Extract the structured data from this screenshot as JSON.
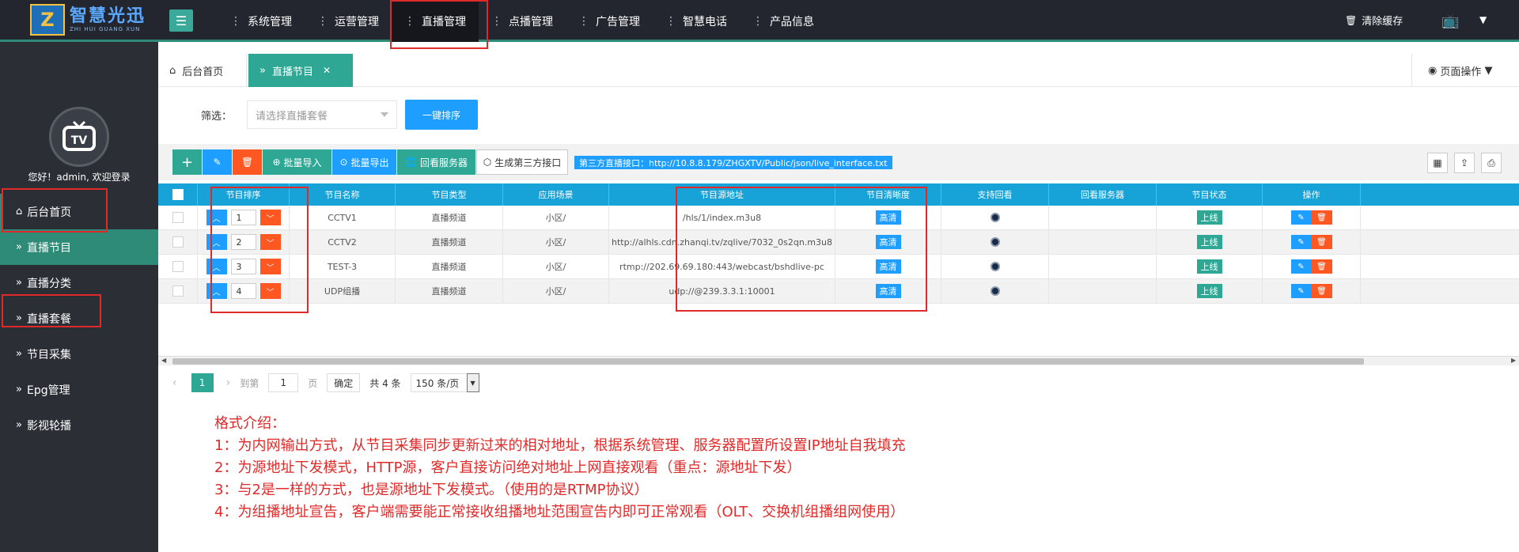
{
  "app": {
    "logo_mark": "Z",
    "logo_cn": "智慧光迅",
    "logo_en": "ZHI HUI GUANG XUN"
  },
  "topnav": {
    "items": [
      "系统管理",
      "运营管理",
      "直播管理",
      "点播管理",
      "广告管理",
      "智慧电话",
      "产品信息"
    ],
    "active": "直播管理",
    "clear_cache": "清除缓存"
  },
  "sidebar": {
    "welcome": "您好！admin, 欢迎登录",
    "items": [
      "后台首页",
      "直播节目",
      "直播分类",
      "直播套餐",
      "节目采集",
      "Epg管理",
      "影视轮播"
    ],
    "active": "直播节目"
  },
  "tabs": {
    "home": "后台首页",
    "current": "直播节目",
    "page_ops": "页面操作"
  },
  "filter": {
    "label": "筛选：",
    "placeholder": "请选择直播套餐",
    "sort_button": "一键排序"
  },
  "toolbar": {
    "import": "批量导入",
    "export": "批量导出",
    "server": "回看服务器",
    "generate": "生成第三方接口",
    "api_link": "第三方直播接口：http://10.8.8.179/ZHGXTV/Public/json/live_interface.txt"
  },
  "table": {
    "headers": [
      "节目排序",
      "节目名称",
      "节目类型",
      "应用场景",
      "节目源地址",
      "节目清晰度",
      "支持回看",
      "回看服务器",
      "节目状态",
      "操作"
    ],
    "rows": [
      {
        "order": "1",
        "name": "CCTV1",
        "type": "直播频道",
        "scene": "小区/",
        "source": "/hls/1/index.m3u8",
        "quality": "高清",
        "server": "",
        "status": "上线"
      },
      {
        "order": "2",
        "name": "CCTV2",
        "type": "直播频道",
        "scene": "小区/",
        "source": "http://alhls.cdn.zhanqi.tv/zqlive/7032_0s2qn.m3u8",
        "quality": "高清",
        "server": "",
        "status": "上线"
      },
      {
        "order": "3",
        "name": "TEST-3",
        "type": "直播频道",
        "scene": "小区/",
        "source": "rtmp://202.69.69.180:443/webcast/bshdlive-pc",
        "quality": "高清",
        "server": "",
        "status": "上线"
      },
      {
        "order": "4",
        "name": "UDP组播",
        "type": "直播频道",
        "scene": "小区/",
        "source": "udp://@239.3.3.1:10001",
        "quality": "高清",
        "server": "",
        "status": "上线"
      }
    ]
  },
  "pager": {
    "current": "1",
    "goto_label": "到第",
    "goto_value": "1",
    "page_label": "页",
    "ok": "确定",
    "total": "共 4 条",
    "page_size": "150 条/页"
  },
  "notes": [
    "格式介绍：",
    "1：为内网输出方式，从节目采集同步更新过来的相对地址，根据系统管理、服务器配置所设置IP地址自我填充",
    "2：为源地址下发模式，HTTP源，客户直接访问绝对地址上网直接观看（重点：源地址下发）",
    "3：与2是一样的方式，也是源地址下发模式。（使用的是RTMP协议）",
    "4：为组播地址宣告，客户端需要能正常接收组播地址范围宣告内即可正常观看（OLT、交换机组播组网使用）"
  ],
  "colors": {
    "accent": "#2ea895",
    "primary": "#1e9fff",
    "danger": "#ff5722",
    "header": "#17a2d8",
    "annotation": "#e02a2a"
  }
}
